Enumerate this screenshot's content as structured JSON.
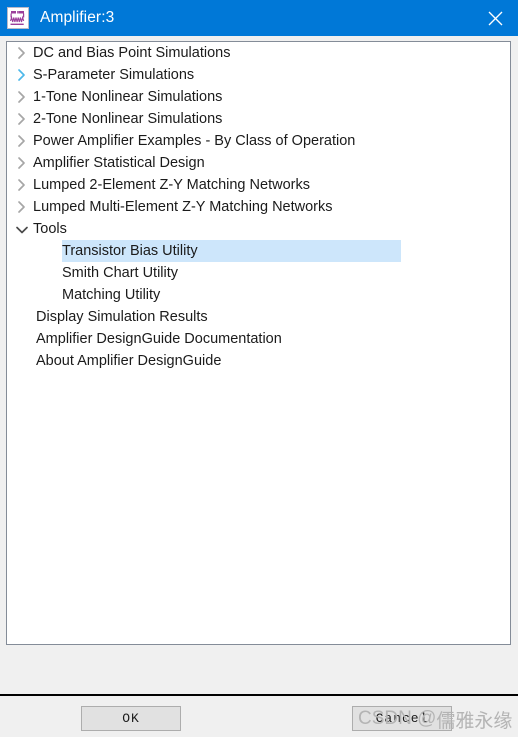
{
  "window": {
    "title": "Amplifier:3",
    "icon": "amplifier-schematic-icon",
    "close_label": "×",
    "titlebar_color": "#0078d7"
  },
  "tree": {
    "items": [
      {
        "label": "DC and Bias Point Simulations",
        "chevron": "chevron-right-icon",
        "state": "collapsed",
        "level": 0,
        "chevron_color": "#a6a6a6"
      },
      {
        "label": "S-Parameter Simulations",
        "chevron": "chevron-right-icon",
        "state": "collapsed",
        "level": 0,
        "chevron_color": "#4db8ea"
      },
      {
        "label": "1-Tone Nonlinear Simulations",
        "chevron": "chevron-right-icon",
        "state": "collapsed",
        "level": 0,
        "chevron_color": "#a6a6a6"
      },
      {
        "label": "2-Tone Nonlinear Simulations",
        "chevron": "chevron-right-icon",
        "state": "collapsed",
        "level": 0,
        "chevron_color": "#a6a6a6"
      },
      {
        "label": "Power Amplifier Examples - By Class of Operation",
        "chevron": "chevron-right-icon",
        "state": "collapsed",
        "level": 0,
        "chevron_color": "#a6a6a6"
      },
      {
        "label": "Amplifier Statistical Design",
        "chevron": "chevron-right-icon",
        "state": "collapsed",
        "level": 0,
        "chevron_color": "#a6a6a6"
      },
      {
        "label": "Lumped 2-Element Z-Y Matching Networks",
        "chevron": "chevron-right-icon",
        "state": "collapsed",
        "level": 0,
        "chevron_color": "#a6a6a6"
      },
      {
        "label": "Lumped Multi-Element Z-Y Matching Networks",
        "chevron": "chevron-right-icon",
        "state": "collapsed",
        "level": 0,
        "chevron_color": "#a6a6a6"
      },
      {
        "label": "Tools",
        "chevron": "chevron-down-icon",
        "state": "expanded",
        "level": 0,
        "chevron_color": "#4a4a4a"
      },
      {
        "label": "Transistor Bias Utility",
        "chevron": "none",
        "state": "selected",
        "level": 1,
        "chevron_color": ""
      },
      {
        "label": "Smith Chart Utility",
        "chevron": "none",
        "state": "normal",
        "level": 1,
        "chevron_color": ""
      },
      {
        "label": "Matching Utility",
        "chevron": "none",
        "state": "normal",
        "level": 1,
        "chevron_color": ""
      },
      {
        "label": "Display Simulation Results",
        "chevron": "none",
        "state": "normal",
        "level": 0,
        "chevron_color": ""
      },
      {
        "label": "Amplifier DesignGuide Documentation",
        "chevron": "none",
        "state": "normal",
        "level": 0,
        "chevron_color": ""
      },
      {
        "label": "About Amplifier DesignGuide",
        "chevron": "none",
        "state": "normal",
        "level": 0,
        "chevron_color": ""
      }
    ],
    "selection_color": "#cde6fb"
  },
  "buttons": {
    "ok_label": "OK",
    "cancel_label": "Cancel"
  },
  "watermark": {
    "latin": "CSDN @",
    "cjk": "儒雅永缘",
    "color": "#b4b4b4"
  }
}
